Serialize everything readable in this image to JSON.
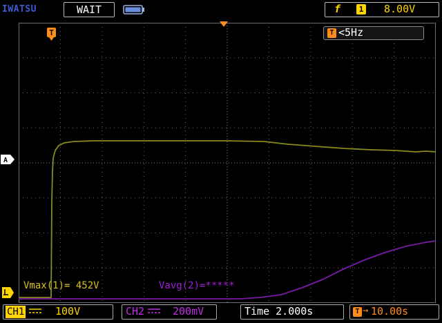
{
  "header": {
    "brand": "IWATSU",
    "status": "WAIT",
    "trigger": {
      "edge_symbol": "f",
      "source": "1",
      "level": "8.00V"
    }
  },
  "screen": {
    "trigger_frequency": "<5Hz",
    "trigger_badge": "T",
    "trigger_marker": "T",
    "channel_a_marker": "A",
    "measurements": {
      "m1": "Vmax(1)= 452V",
      "m2": "Vavg(2)=*****"
    }
  },
  "footer": {
    "ch1": {
      "name": "CH1",
      "scale": "100V"
    },
    "ch2": {
      "name": "CH2",
      "scale": "200mV"
    },
    "timebase": "Time 2.000s",
    "delay_badge": "T",
    "delay_arrow": "→",
    "delay": "10.00s"
  },
  "colors": {
    "ch1": "#ffd400",
    "ch1_trace": "#8a8a1e",
    "ch2": "#a01fd8",
    "trigger": "#ff8c1a",
    "brand": "#3c5bd6",
    "grid": "#6e6e6e"
  }
}
